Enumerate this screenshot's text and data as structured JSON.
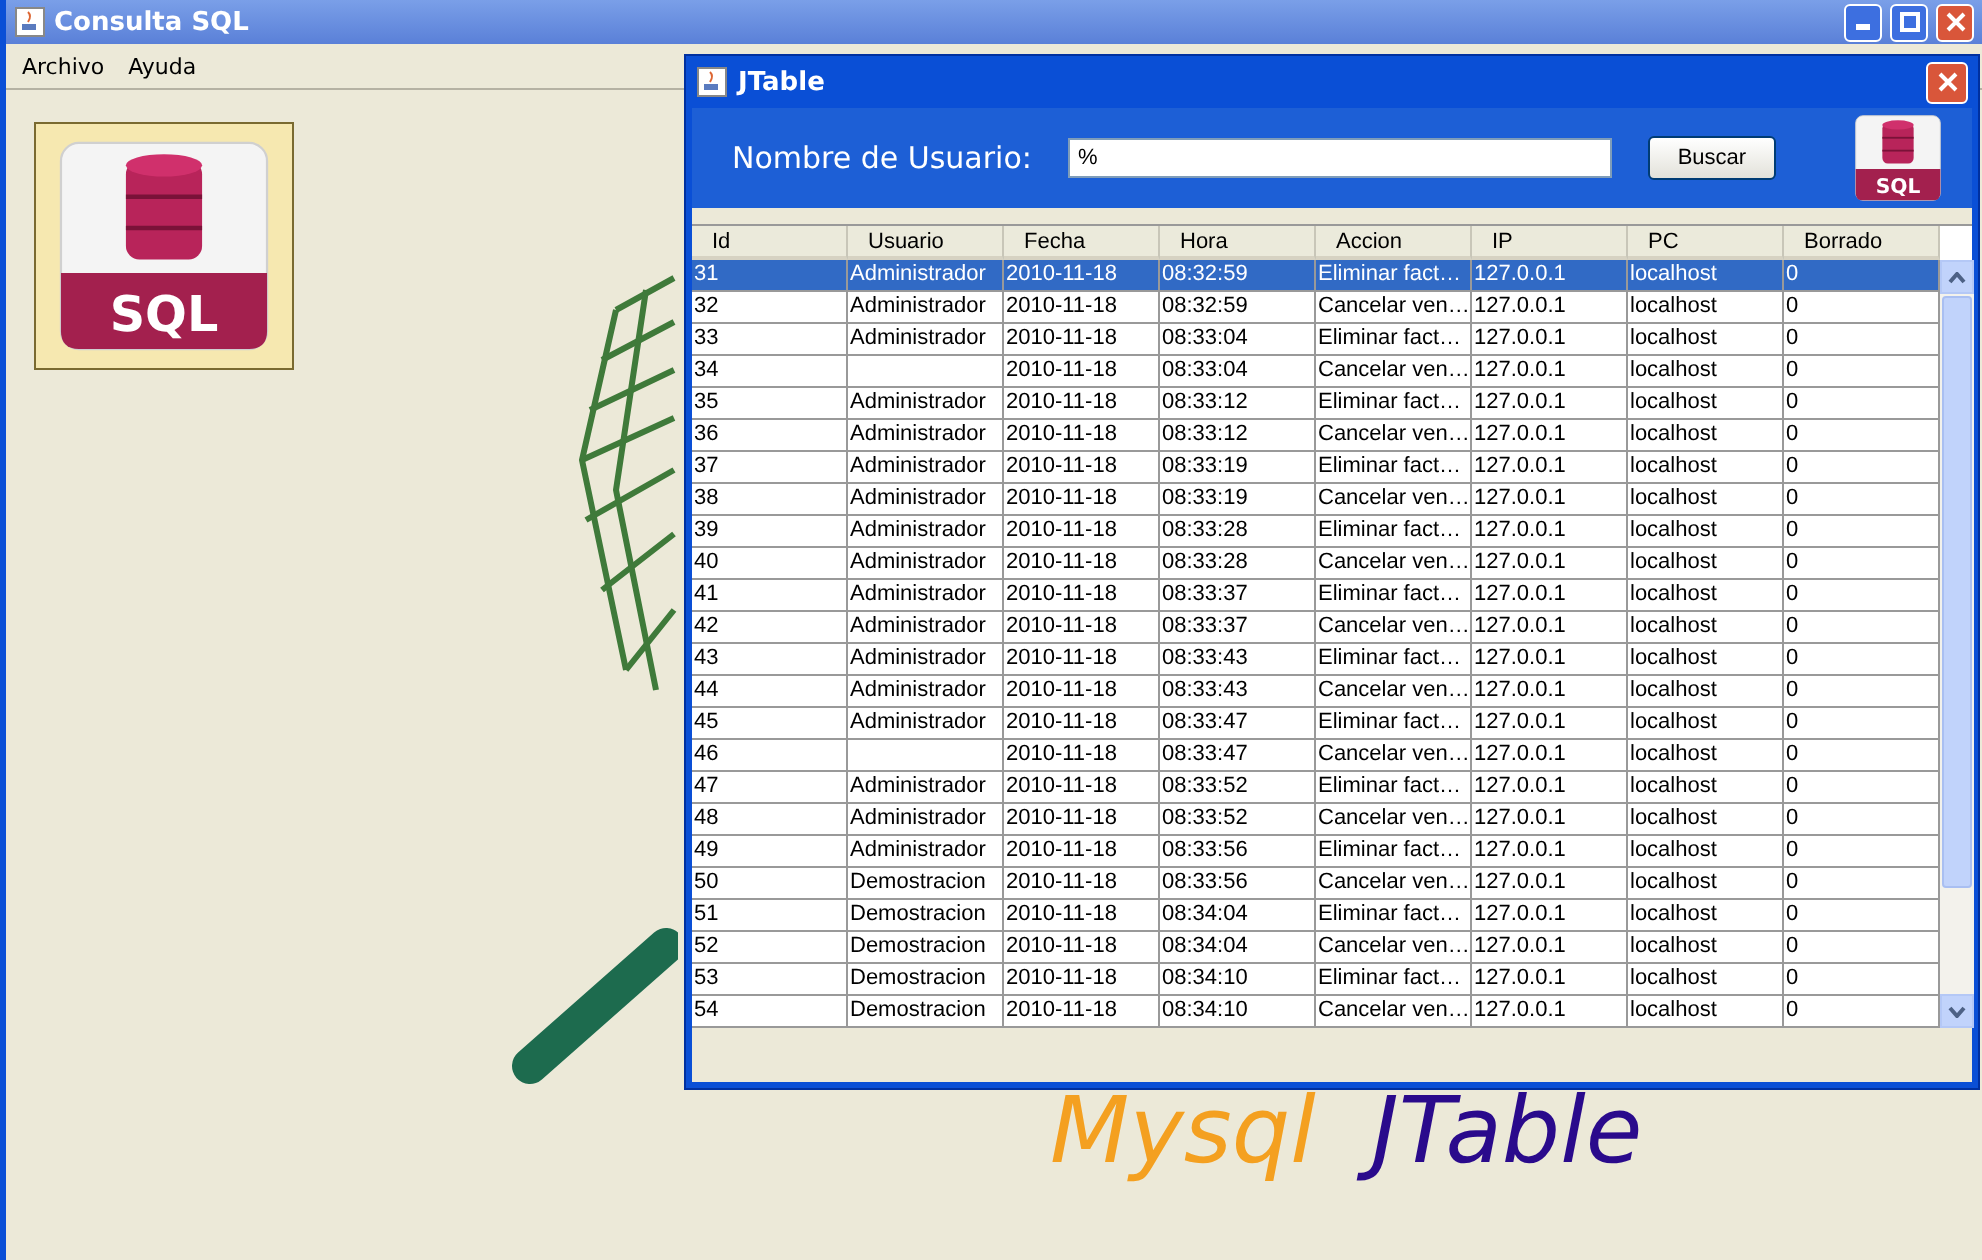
{
  "window": {
    "title": "Consulta SQL"
  },
  "menu": [
    "Archivo",
    "Ayuda"
  ],
  "desktop_icon": {
    "label": "SQL"
  },
  "banner": {
    "word_1": "Mysql",
    "word_2": "JTable"
  },
  "dialog": {
    "title": "JTable",
    "search_label": "Nombre de Usuario:",
    "search_value": "%",
    "search_button": "Buscar",
    "icon_label": "SQL",
    "table": {
      "columns": [
        "Id",
        "Usuario",
        "Fecha",
        "Hora",
        "Accion",
        "IP",
        "PC",
        "Borrado"
      ],
      "rows": [
        {
          "selected": true,
          "cells": [
            "31",
            "Administrador",
            "2010-11-18",
            "08:32:59",
            "Eliminar fact…",
            "127.0.0.1",
            "localhost",
            "0"
          ]
        },
        {
          "selected": false,
          "cells": [
            "32",
            "Administrador",
            "2010-11-18",
            "08:32:59",
            "Cancelar ven…",
            "127.0.0.1",
            "localhost",
            "0"
          ]
        },
        {
          "selected": false,
          "cells": [
            "33",
            "Administrador",
            "2010-11-18",
            "08:33:04",
            "Eliminar fact…",
            "127.0.0.1",
            "localhost",
            "0"
          ]
        },
        {
          "selected": false,
          "cells": [
            "34",
            null,
            "2010-11-18",
            "08:33:04",
            "Cancelar ven…",
            "127.0.0.1",
            "localhost",
            "0"
          ]
        },
        {
          "selected": false,
          "cells": [
            "35",
            "Administrador",
            "2010-11-18",
            "08:33:12",
            "Eliminar fact…",
            "127.0.0.1",
            "localhost",
            "0"
          ]
        },
        {
          "selected": false,
          "cells": [
            "36",
            "Administrador",
            "2010-11-18",
            "08:33:12",
            "Cancelar ven…",
            "127.0.0.1",
            "localhost",
            "0"
          ]
        },
        {
          "selected": false,
          "cells": [
            "37",
            "Administrador",
            "2010-11-18",
            "08:33:19",
            "Eliminar fact…",
            "127.0.0.1",
            "localhost",
            "0"
          ]
        },
        {
          "selected": false,
          "cells": [
            "38",
            "Administrador",
            "2010-11-18",
            "08:33:19",
            "Cancelar ven…",
            "127.0.0.1",
            "localhost",
            "0"
          ]
        },
        {
          "selected": false,
          "cells": [
            "39",
            "Administrador",
            "2010-11-18",
            "08:33:28",
            "Eliminar fact…",
            "127.0.0.1",
            "localhost",
            "0"
          ]
        },
        {
          "selected": false,
          "cells": [
            "40",
            "Administrador",
            "2010-11-18",
            "08:33:28",
            "Cancelar ven…",
            "127.0.0.1",
            "localhost",
            "0"
          ]
        },
        {
          "selected": false,
          "cells": [
            "41",
            "Administrador",
            "2010-11-18",
            "08:33:37",
            "Eliminar fact…",
            "127.0.0.1",
            "localhost",
            "0"
          ]
        },
        {
          "selected": false,
          "cells": [
            "42",
            "Administrador",
            "2010-11-18",
            "08:33:37",
            "Cancelar ven…",
            "127.0.0.1",
            "localhost",
            "0"
          ]
        },
        {
          "selected": false,
          "cells": [
            "43",
            "Administrador",
            "2010-11-18",
            "08:33:43",
            "Eliminar fact…",
            "127.0.0.1",
            "localhost",
            "0"
          ]
        },
        {
          "selected": false,
          "cells": [
            "44",
            "Administrador",
            "2010-11-18",
            "08:33:43",
            "Cancelar ven…",
            "127.0.0.1",
            "localhost",
            "0"
          ]
        },
        {
          "selected": false,
          "cells": [
            "45",
            "Administrador",
            "2010-11-18",
            "08:33:47",
            "Eliminar fact…",
            "127.0.0.1",
            "localhost",
            "0"
          ]
        },
        {
          "selected": false,
          "cells": [
            "46",
            null,
            "2010-11-18",
            "08:33:47",
            "Cancelar ven…",
            "127.0.0.1",
            "localhost",
            "0"
          ]
        },
        {
          "selected": false,
          "cells": [
            "47",
            "Administrador",
            "2010-11-18",
            "08:33:52",
            "Eliminar fact…",
            "127.0.0.1",
            "localhost",
            "0"
          ]
        },
        {
          "selected": false,
          "cells": [
            "48",
            "Administrador",
            "2010-11-18",
            "08:33:52",
            "Cancelar ven…",
            "127.0.0.1",
            "localhost",
            "0"
          ]
        },
        {
          "selected": false,
          "cells": [
            "49",
            "Administrador",
            "2010-11-18",
            "08:33:56",
            "Eliminar fact…",
            "127.0.0.1",
            "localhost",
            "0"
          ]
        },
        {
          "selected": false,
          "cells": [
            "50",
            "Demostracion",
            "2010-11-18",
            "08:33:56",
            "Cancelar ven…",
            "127.0.0.1",
            "localhost",
            "0"
          ]
        },
        {
          "selected": false,
          "cells": [
            "51",
            "Demostracion",
            "2010-11-18",
            "08:34:04",
            "Eliminar fact…",
            "127.0.0.1",
            "localhost",
            "0"
          ]
        },
        {
          "selected": false,
          "cells": [
            "52",
            "Demostracion",
            "2010-11-18",
            "08:34:04",
            "Cancelar ven…",
            "127.0.0.1",
            "localhost",
            "0"
          ]
        },
        {
          "selected": false,
          "cells": [
            "53",
            "Demostracion",
            "2010-11-18",
            "08:34:10",
            "Eliminar fact…",
            "127.0.0.1",
            "localhost",
            "0"
          ]
        },
        {
          "selected": false,
          "cells": [
            "54",
            "Demostracion",
            "2010-11-18",
            "08:34:10",
            "Cancelar ven…",
            "127.0.0.1",
            "localhost",
            "0"
          ]
        }
      ]
    }
  }
}
